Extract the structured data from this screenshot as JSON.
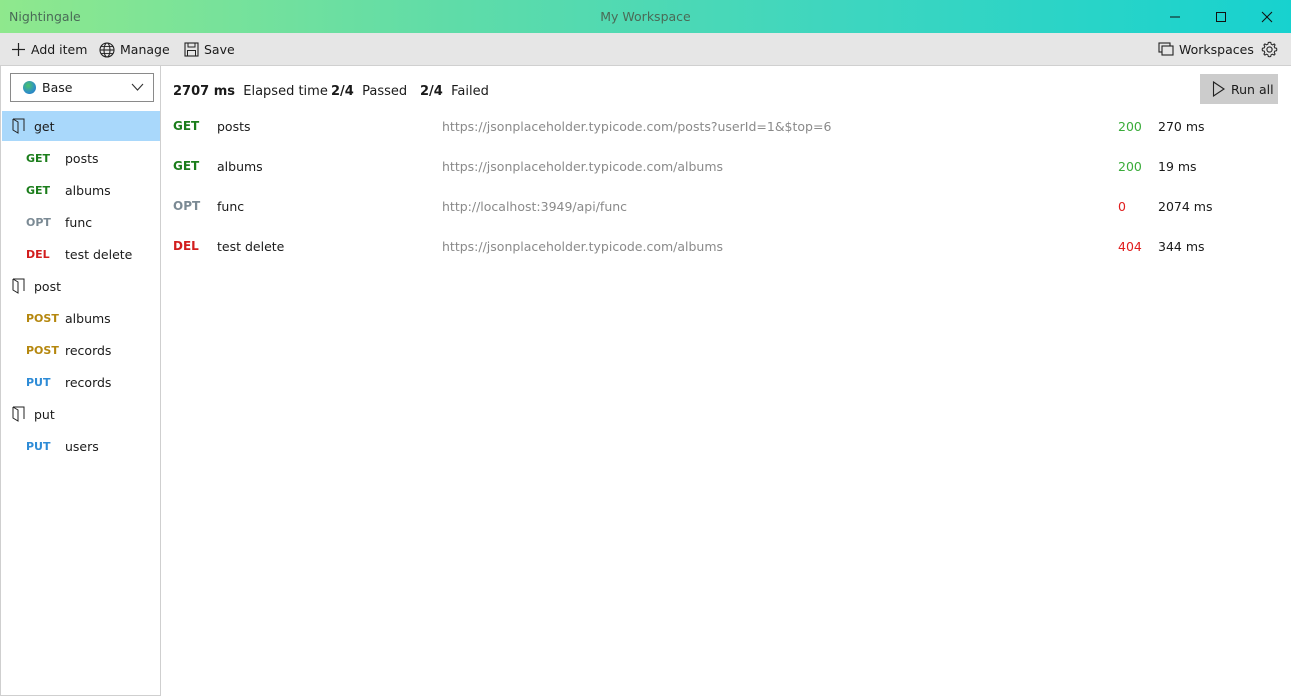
{
  "titlebar": {
    "app_name": "Nightingale",
    "window_title": "My Workspace"
  },
  "toolbar": {
    "add_item": "Add item",
    "manage": "Manage",
    "save": "Save",
    "workspaces": "Workspaces"
  },
  "environment": {
    "selected": "Base"
  },
  "sidebar": {
    "tree": [
      {
        "type": "folder",
        "label": "get",
        "selected": true
      },
      {
        "type": "request",
        "method": "GET",
        "label": "posts"
      },
      {
        "type": "request",
        "method": "GET",
        "label": "albums"
      },
      {
        "type": "request",
        "method": "OPT",
        "label": "func"
      },
      {
        "type": "request",
        "method": "DEL",
        "label": "test delete"
      },
      {
        "type": "folder",
        "label": "post"
      },
      {
        "type": "request",
        "method": "POST",
        "label": "albums"
      },
      {
        "type": "request",
        "method": "POST",
        "label": "records"
      },
      {
        "type": "request",
        "method": "PUT",
        "label": "records"
      },
      {
        "type": "folder",
        "label": "put"
      },
      {
        "type": "request",
        "method": "PUT",
        "label": "users"
      }
    ]
  },
  "summary": {
    "elapsed_value": "2707 ms",
    "elapsed_label": "Elapsed time",
    "passed_value": "2/4",
    "passed_label": "Passed",
    "failed_value": "2/4",
    "failed_label": "Failed"
  },
  "run_all_label": "Run all",
  "results": [
    {
      "method": "GET",
      "name": "posts",
      "url": "https://jsonplaceholder.typicode.com/posts?userId=1&$top=6",
      "status": "200",
      "time": "270 ms",
      "ok": true
    },
    {
      "method": "GET",
      "name": "albums",
      "url": "https://jsonplaceholder.typicode.com/albums",
      "status": "200",
      "time": "19 ms",
      "ok": true
    },
    {
      "method": "OPT",
      "name": "func",
      "url": "http://localhost:3949/api/func",
      "status": "0",
      "time": "2074 ms",
      "ok": false
    },
    {
      "method": "DEL",
      "name": "test delete",
      "url": "https://jsonplaceholder.typicode.com/albums",
      "status": "404",
      "time": "344 ms",
      "ok": false
    }
  ],
  "colors": {
    "GET": "#1b7d1b",
    "OPT": "#7b8a94",
    "DEL": "#d21d1d",
    "POST": "#b5870e",
    "PUT": "#2e8bd6",
    "selected_row": "#a9d8fb",
    "status_ok": "#3aac3a",
    "status_bad": "#e01e1e"
  }
}
